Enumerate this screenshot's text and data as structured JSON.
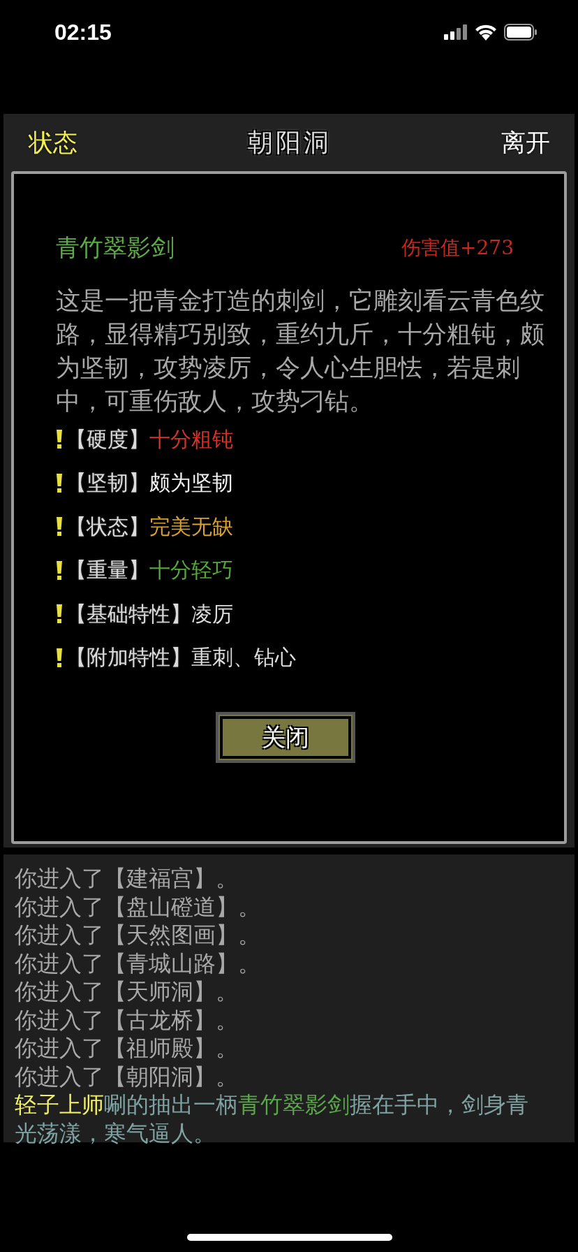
{
  "status_bar": {
    "time": "02:15"
  },
  "header": {
    "left": "状态",
    "title": "朝阳洞",
    "right": "离开"
  },
  "item": {
    "name": "青竹翠影剑",
    "damage": "伤害值+273",
    "description": "这是一把青金打造的刺剑，它雕刻看云青色纹路，显得精巧别致，重约九斤，十分粗钝，颇为坚韧，攻势凌厉，令人心生胆怯，若是刺中，可重伤敌人，攻势刁钻。",
    "attributes": [
      {
        "label": "【硬度】",
        "value": "十分粗钝",
        "color": "#d8322a"
      },
      {
        "label": "【坚韧】",
        "value": "颇为坚韧",
        "color": "#f2f2f2"
      },
      {
        "label": "【状态】",
        "value": "完美无缺",
        "color": "#d9a030"
      },
      {
        "label": "【重量】",
        "value": "十分轻巧",
        "color": "#55aa3c"
      },
      {
        "label": "【基础特性】",
        "value": "凌厉",
        "color": "#dcdcdc"
      },
      {
        "label": "【附加特性】",
        "value": "重刺、钻心",
        "color": "#dcdcdc"
      }
    ],
    "close_button": "关闭"
  },
  "log": [
    [
      {
        "text": "你进入了【建福宫】。",
        "color": "#a8a8a8"
      }
    ],
    [
      {
        "text": "你进入了【盘山磴道】。",
        "color": "#a8a8a8"
      }
    ],
    [
      {
        "text": "你进入了【天然图画】。",
        "color": "#a8a8a8"
      }
    ],
    [
      {
        "text": "你进入了【青城山路】。",
        "color": "#a8a8a8"
      }
    ],
    [
      {
        "text": "你进入了【天师洞】。",
        "color": "#a8a8a8"
      }
    ],
    [
      {
        "text": "你进入了【古龙桥】。",
        "color": "#a8a8a8"
      }
    ],
    [
      {
        "text": "你进入了【祖师殿】。",
        "color": "#a8a8a8"
      }
    ],
    [
      {
        "text": "你进入了【朝阳洞】。",
        "color": "#a8a8a8"
      }
    ],
    [
      {
        "text": "轻子上师",
        "color": "#f2f060"
      },
      {
        "text": "唰的抽出一柄",
        "color": "#7fa3a3"
      },
      {
        "text": "青竹翠影剑",
        "color": "#58a848"
      },
      {
        "text": "握在手中，剑身青光荡漾，寒气逼人。",
        "color": "#7fa3a3"
      }
    ]
  ]
}
